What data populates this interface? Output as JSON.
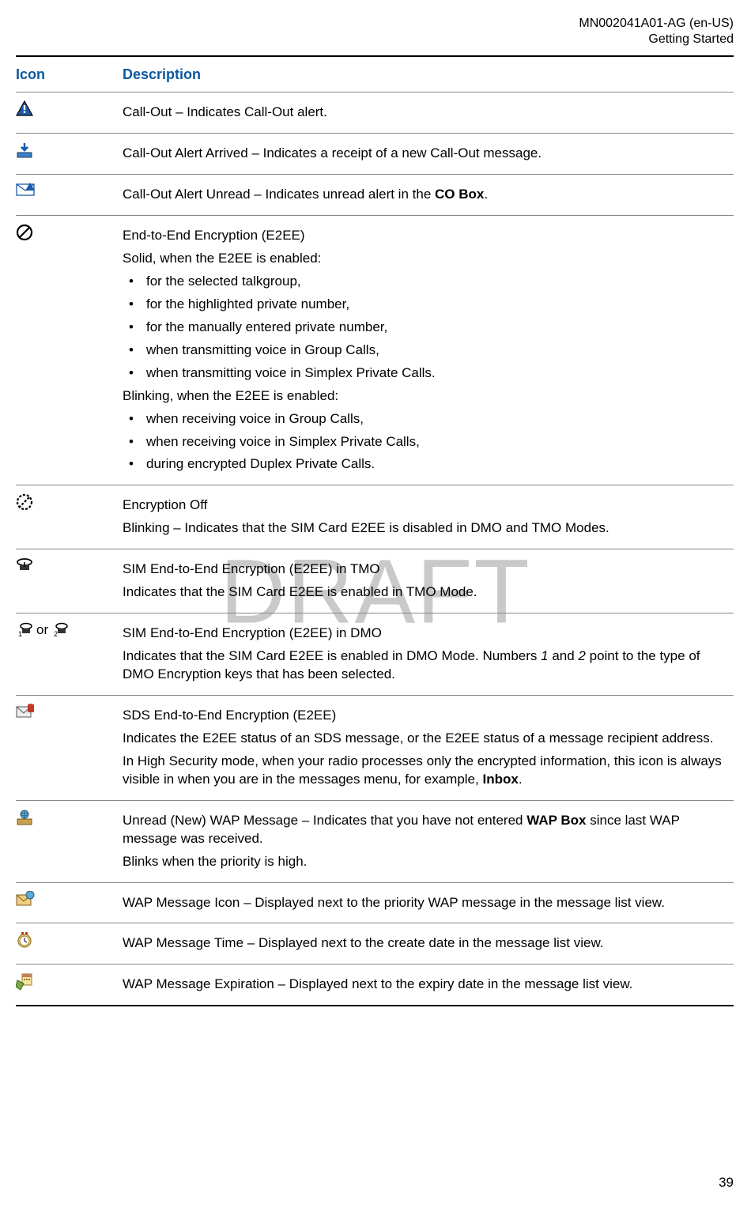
{
  "meta": {
    "doc_id": "MN002041A01-AG (en-US)",
    "section": "Getting Started"
  },
  "watermark": "DRAFT",
  "page_number": "39",
  "table": {
    "col_icon": "Icon",
    "col_desc": "Description"
  },
  "rows": {
    "callout": {
      "line1": "Call-Out – Indicates Call-Out alert."
    },
    "callout_arrived": {
      "line1": "Call-Out Alert Arrived – Indicates a receipt of a new Call-Out message."
    },
    "callout_unread": {
      "pre": "Call-Out Alert Unread – Indicates unread alert in the ",
      "bold": "CO Box",
      "post": "."
    },
    "e2ee": {
      "title": "End-to-End Encryption (E2EE)",
      "solid_intro": "Solid, when the E2EE is enabled:",
      "solid_items": [
        "for the selected talkgroup,",
        "for the highlighted private number,",
        "for the manually entered private number,",
        "when transmitting voice in Group Calls,",
        "when transmitting voice in Simplex Private Calls."
      ],
      "blink_intro": "Blinking, when the E2EE is enabled:",
      "blink_items": [
        "when receiving voice in Group Calls,",
        "when receiving voice in Simplex Private Calls,",
        "during encrypted Duplex Private Calls."
      ]
    },
    "enc_off": {
      "title": "Encryption Off",
      "line2": "Blinking – Indicates that the SIM Card E2EE is disabled in DMO and TMO Modes."
    },
    "sim_tmo": {
      "title": "SIM End-to-End Encryption (E2EE) in TMO",
      "line2": "Indicates that the SIM Card E2EE is enabled in TMO Mode."
    },
    "sim_dmo": {
      "or_text": "or",
      "title": "SIM End-to-End Encryption (E2EE) in DMO",
      "pre": "Indicates that the SIM Card E2EE is enabled in DMO Mode. Numbers ",
      "n1": "1",
      "mid": " and ",
      "n2": "2",
      "post": " point to the type of DMO Encryption keys that has been selected."
    },
    "sds_e2ee": {
      "title": "SDS End-to-End Encryption (E2EE)",
      "line2": "Indicates the E2EE status of an SDS message, or the E2EE status of a message recipient address.",
      "pre": "In High Security mode, when your radio processes only the encrypted information, this icon is always visible in when you are in the messages menu, for example, ",
      "bold": "Inbox",
      "post": "."
    },
    "wap_unread": {
      "pre": "Unread (New) WAP Message – Indicates that you have not entered ",
      "bold": "WAP Box",
      "post": " since last WAP message was received.",
      "line2": "Blinks when the priority is high."
    },
    "wap_icon": {
      "line1": "WAP Message Icon – Displayed next to the priority WAP message in the message list view."
    },
    "wap_time": {
      "line1": "WAP Message Time – Displayed next to the create date in the message list view."
    },
    "wap_expiration": {
      "line1": "WAP Message Expiration – Displayed next to the expiry date in the message list view."
    }
  }
}
